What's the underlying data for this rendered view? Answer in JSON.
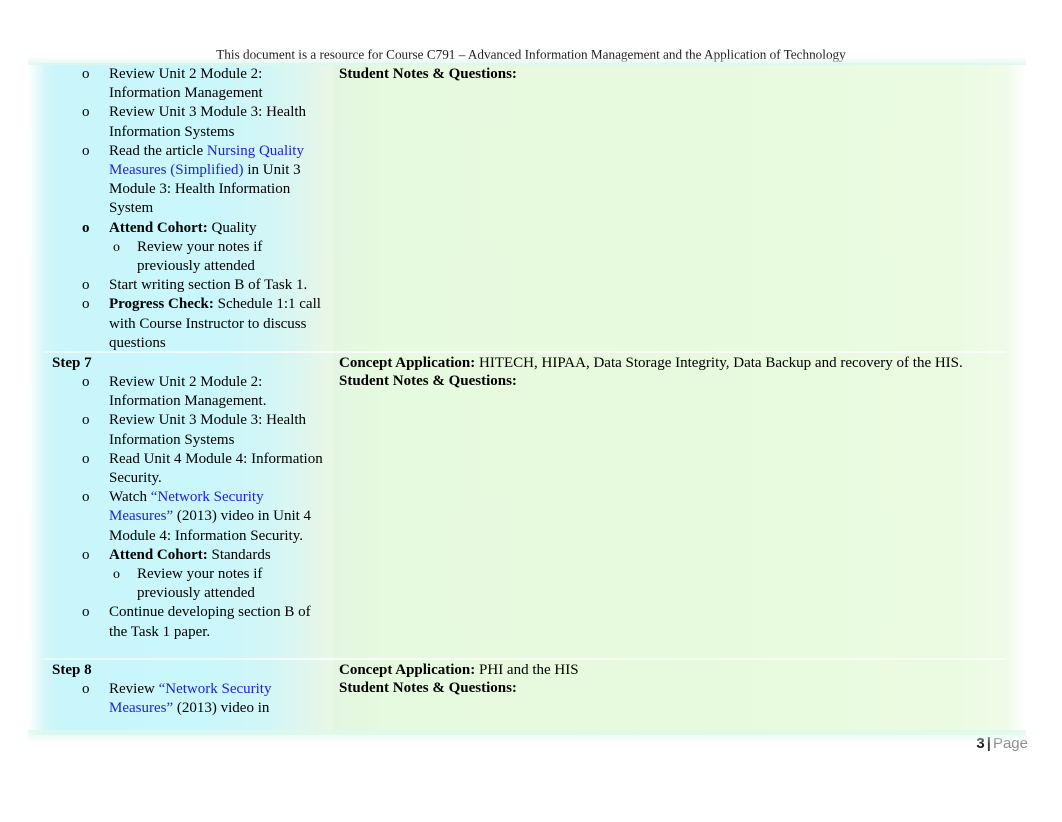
{
  "header": {
    "text": "This document is a resource for Course C791 – Advanced Information Management and the Application of Technology"
  },
  "footer": {
    "page_number": "3",
    "separator": "|",
    "page_word": "Page"
  },
  "colors": {
    "left_cell": "#c9f7fc",
    "right_cell": "#e8fade",
    "link": "#2222dd",
    "text": "#000000",
    "footer_word": "#8a8a8a"
  },
  "table": {
    "rows": [
      {
        "step_label": "",
        "left_items": [
          {
            "bullet": "o",
            "bullet_bold": false,
            "text": "Review Unit 2 Module 2: Information Management"
          },
          {
            "bullet": "o",
            "bullet_bold": false,
            "text": "Review Unit 3 Module 3: Health Information Systems"
          },
          {
            "bullet": "o",
            "bullet_bold": false,
            "pre": "Read the article ",
            "link": "Nursing Quality Measures (Simplified)",
            "post": " in Unit 3 Module 3: Health Information System"
          },
          {
            "bullet": "o",
            "bullet_bold": true,
            "bold_lead": "Attend Cohort:",
            "text": " Quality",
            "subitems": [
              {
                "bullet": "o",
                "text": "Review your notes if previously attended"
              }
            ]
          },
          {
            "bullet": "o",
            "bullet_bold": false,
            "text": "Start writing section B of Task 1."
          },
          {
            "bullet": "o",
            "bullet_bold": false,
            "bold_lead": "Progress Check:",
            "text": " Schedule 1:1 call with Course Instructor to discuss questions"
          }
        ],
        "right_lines": [
          {
            "bold_lead": "Student Notes & Questions:",
            "text": ""
          }
        ]
      },
      {
        "step_label": "Step 7",
        "left_items": [
          {
            "bullet": "o",
            "bullet_bold": false,
            "text": "Review Unit 2 Module 2: Information Management."
          },
          {
            "bullet": "o",
            "bullet_bold": false,
            "text": "Review Unit 3 Module 3: Health Information Systems"
          },
          {
            "bullet": "o",
            "bullet_bold": false,
            "text": "Read Unit 4 Module 4: Information Security."
          },
          {
            "bullet": "o",
            "bullet_bold": false,
            "pre": "Watch ",
            "link": "“Network Security Measures”",
            "post": " (2013) video in Unit 4 Module 4: Information Security."
          },
          {
            "bullet": "o",
            "bullet_bold": false,
            "bold_lead": "Attend Cohort:",
            "text": " Standards",
            "subitems": [
              {
                "bullet": "o",
                "text": "Review your notes if previously attended"
              }
            ]
          },
          {
            "bullet": "o",
            "bullet_bold": false,
            "text": "Continue developing section B of the Task 1 paper."
          }
        ],
        "right_lines": [
          {
            "bold_lead": "Concept Application:",
            "text": " HITECH, HIPAA, Data Storage Integrity, Data Backup and recovery of the HIS."
          },
          {
            "bold_lead": "Student Notes & Questions:",
            "text": ""
          }
        ]
      },
      {
        "step_label": "Step 8",
        "left_items": [
          {
            "bullet": "o",
            "bullet_bold": false,
            "pre": "Review ",
            "link": "“Network Security Measures”",
            "post": " (2013) video in"
          }
        ],
        "right_lines": [
          {
            "bold_lead": "Concept Application:",
            "text": " PHI and the HIS"
          },
          {
            "bold_lead": "Student Notes & Questions:",
            "text": ""
          }
        ]
      }
    ]
  }
}
